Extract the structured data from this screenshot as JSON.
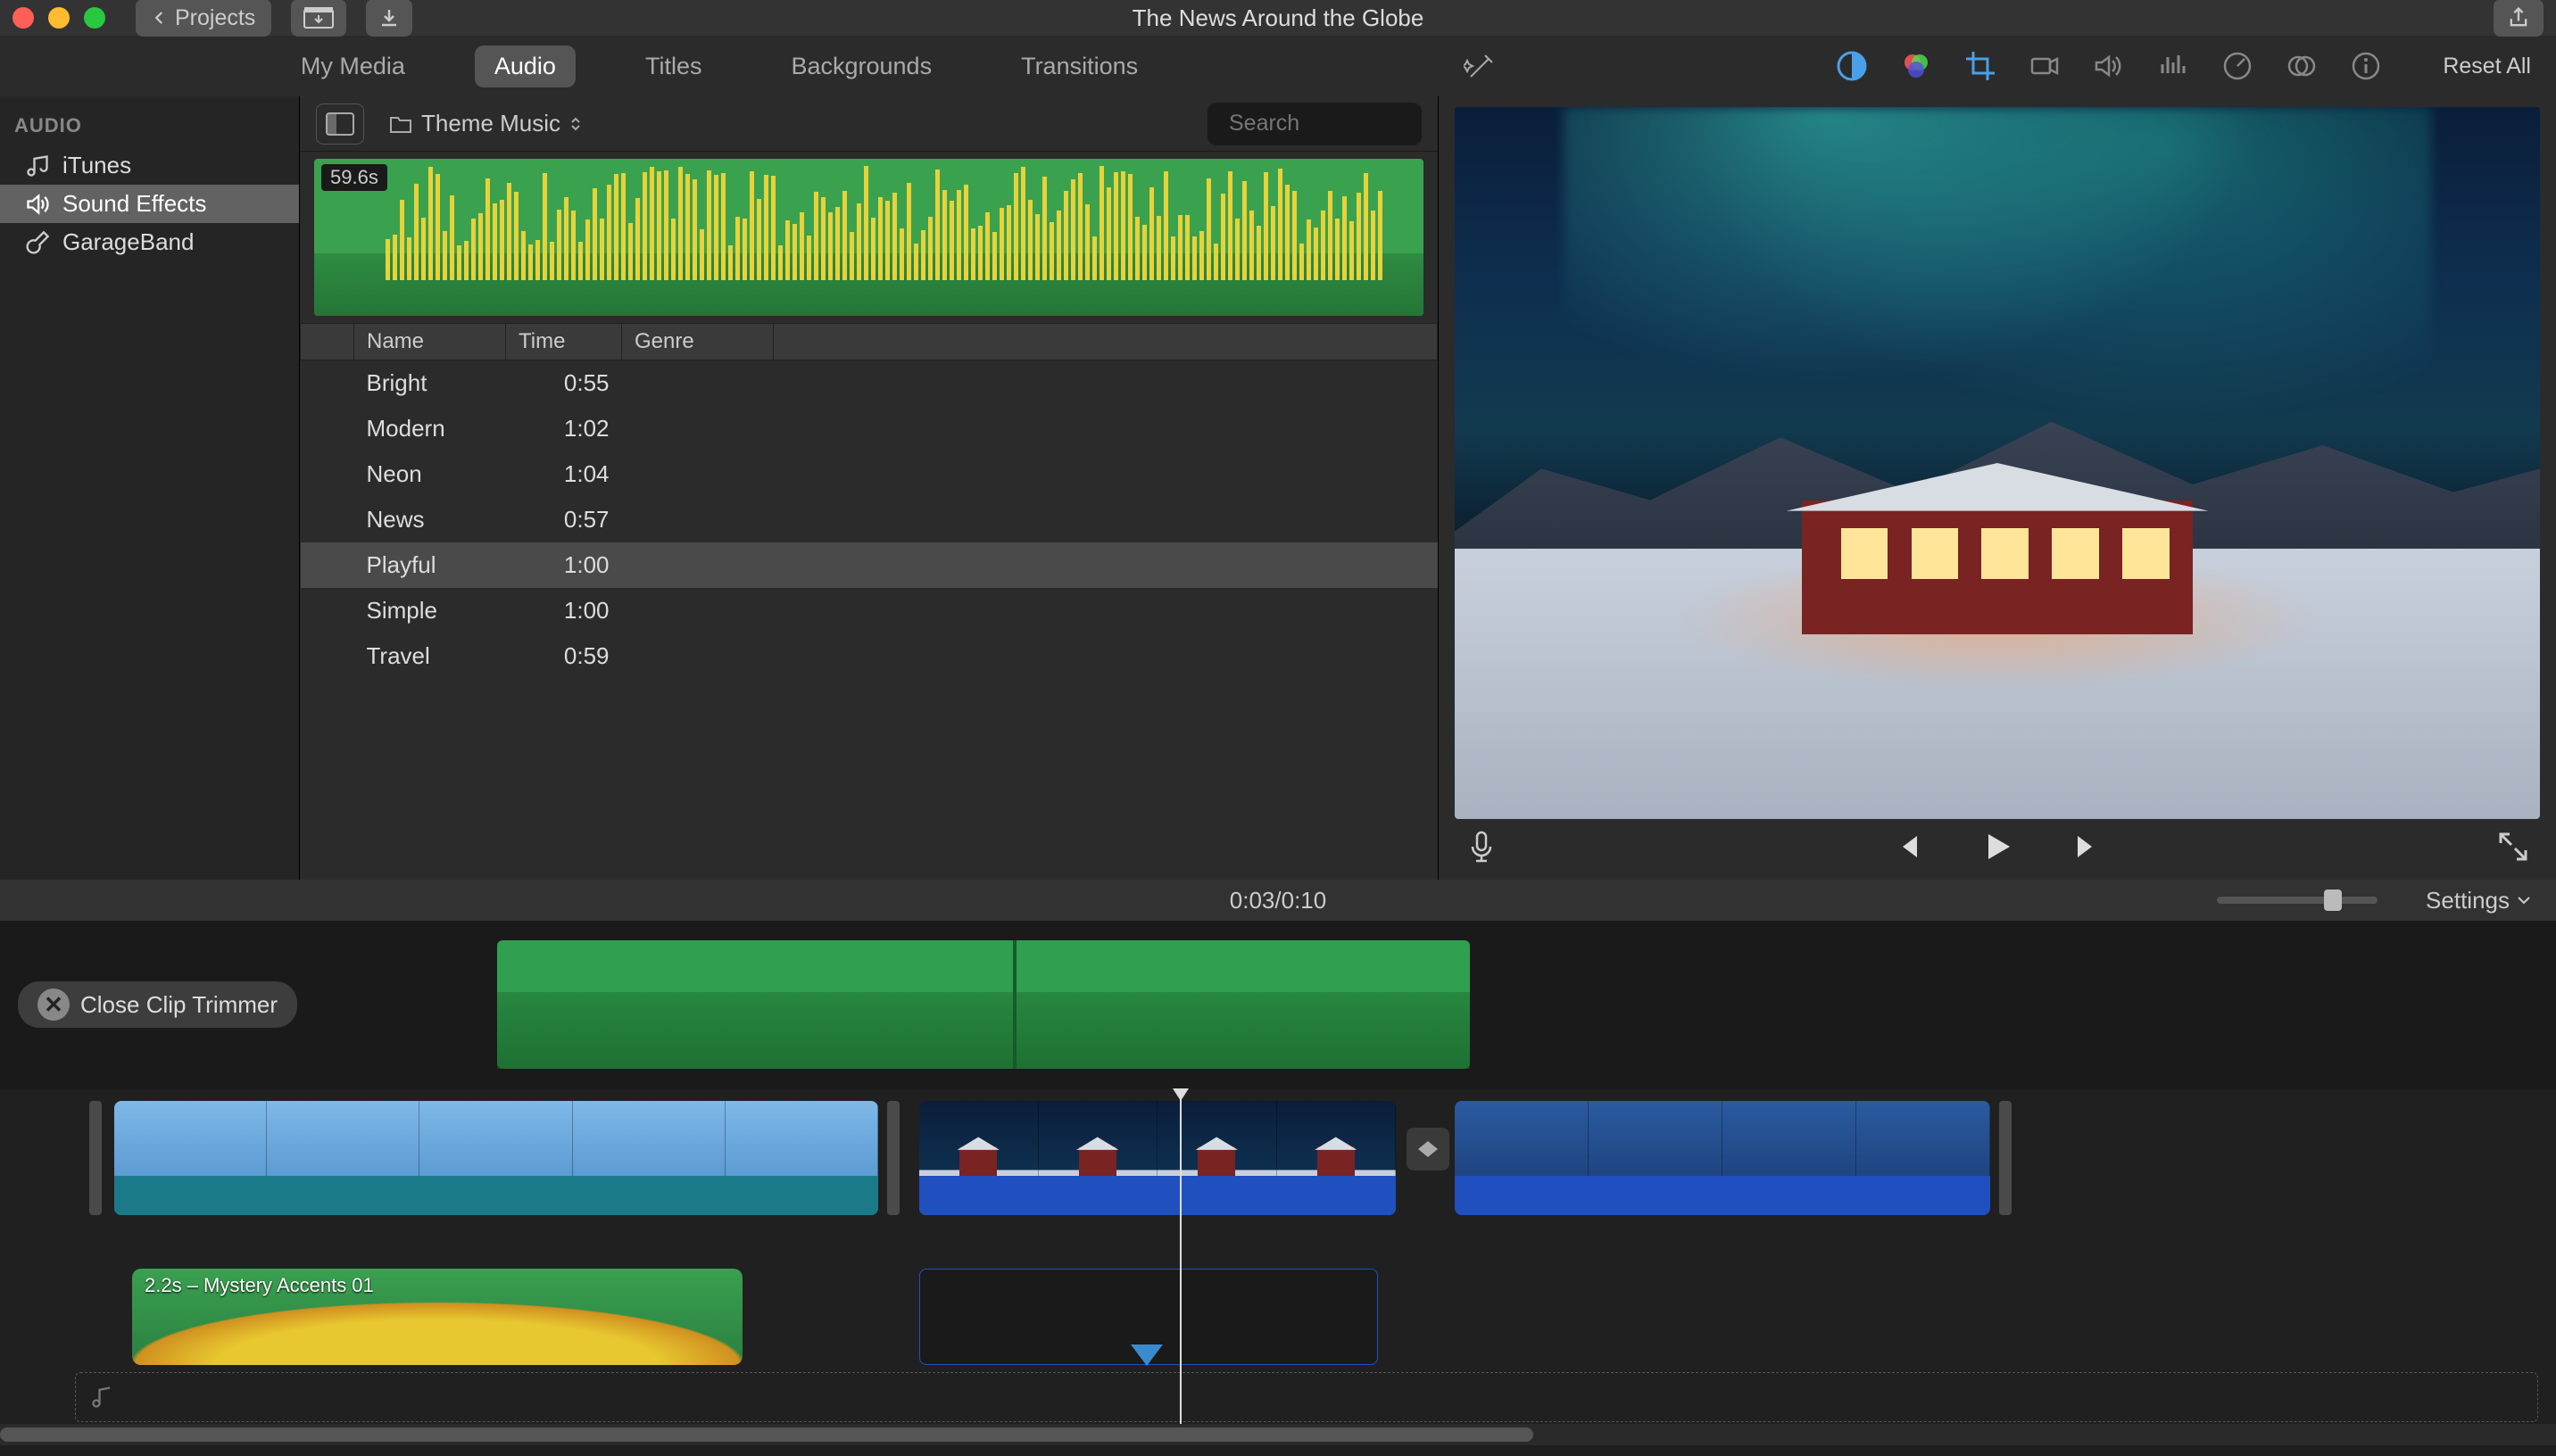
{
  "titlebar": {
    "projects_label": "Projects",
    "project_title": "The News Around the Globe"
  },
  "tabs": {
    "items": [
      "My Media",
      "Audio",
      "Titles",
      "Backgrounds",
      "Transitions"
    ],
    "active": "Audio",
    "reset_label": "Reset All"
  },
  "sidebar": {
    "title": "AUDIO",
    "items": [
      {
        "label": "iTunes",
        "icon": "music-note-icon"
      },
      {
        "label": "Sound Effects",
        "icon": "speaker-icon",
        "active": true
      },
      {
        "label": "GarageBand",
        "icon": "guitar-icon"
      }
    ]
  },
  "browser": {
    "folder_label": "Theme Music",
    "search_placeholder": "Search",
    "waveform_badge": "59.6s",
    "columns": [
      "",
      "Name",
      "Time",
      "Genre"
    ],
    "rows": [
      {
        "name": "Bright",
        "time": "0:55",
        "genre": ""
      },
      {
        "name": "Modern",
        "time": "1:02",
        "genre": ""
      },
      {
        "name": "Neon",
        "time": "1:04",
        "genre": ""
      },
      {
        "name": "News",
        "time": "0:57",
        "genre": ""
      },
      {
        "name": "Playful",
        "time": "1:00",
        "genre": "",
        "selected": true
      },
      {
        "name": "Simple",
        "time": "1:00",
        "genre": ""
      },
      {
        "name": "Travel",
        "time": "0:59",
        "genre": ""
      }
    ]
  },
  "info": {
    "current": "0:03",
    "sep": " / ",
    "total": "0:10",
    "settings_label": "Settings"
  },
  "trimmer": {
    "close_label": "Close Clip Trimmer"
  },
  "timeline": {
    "audio_clip_label": "2.2s – Mystery Accents 01"
  }
}
